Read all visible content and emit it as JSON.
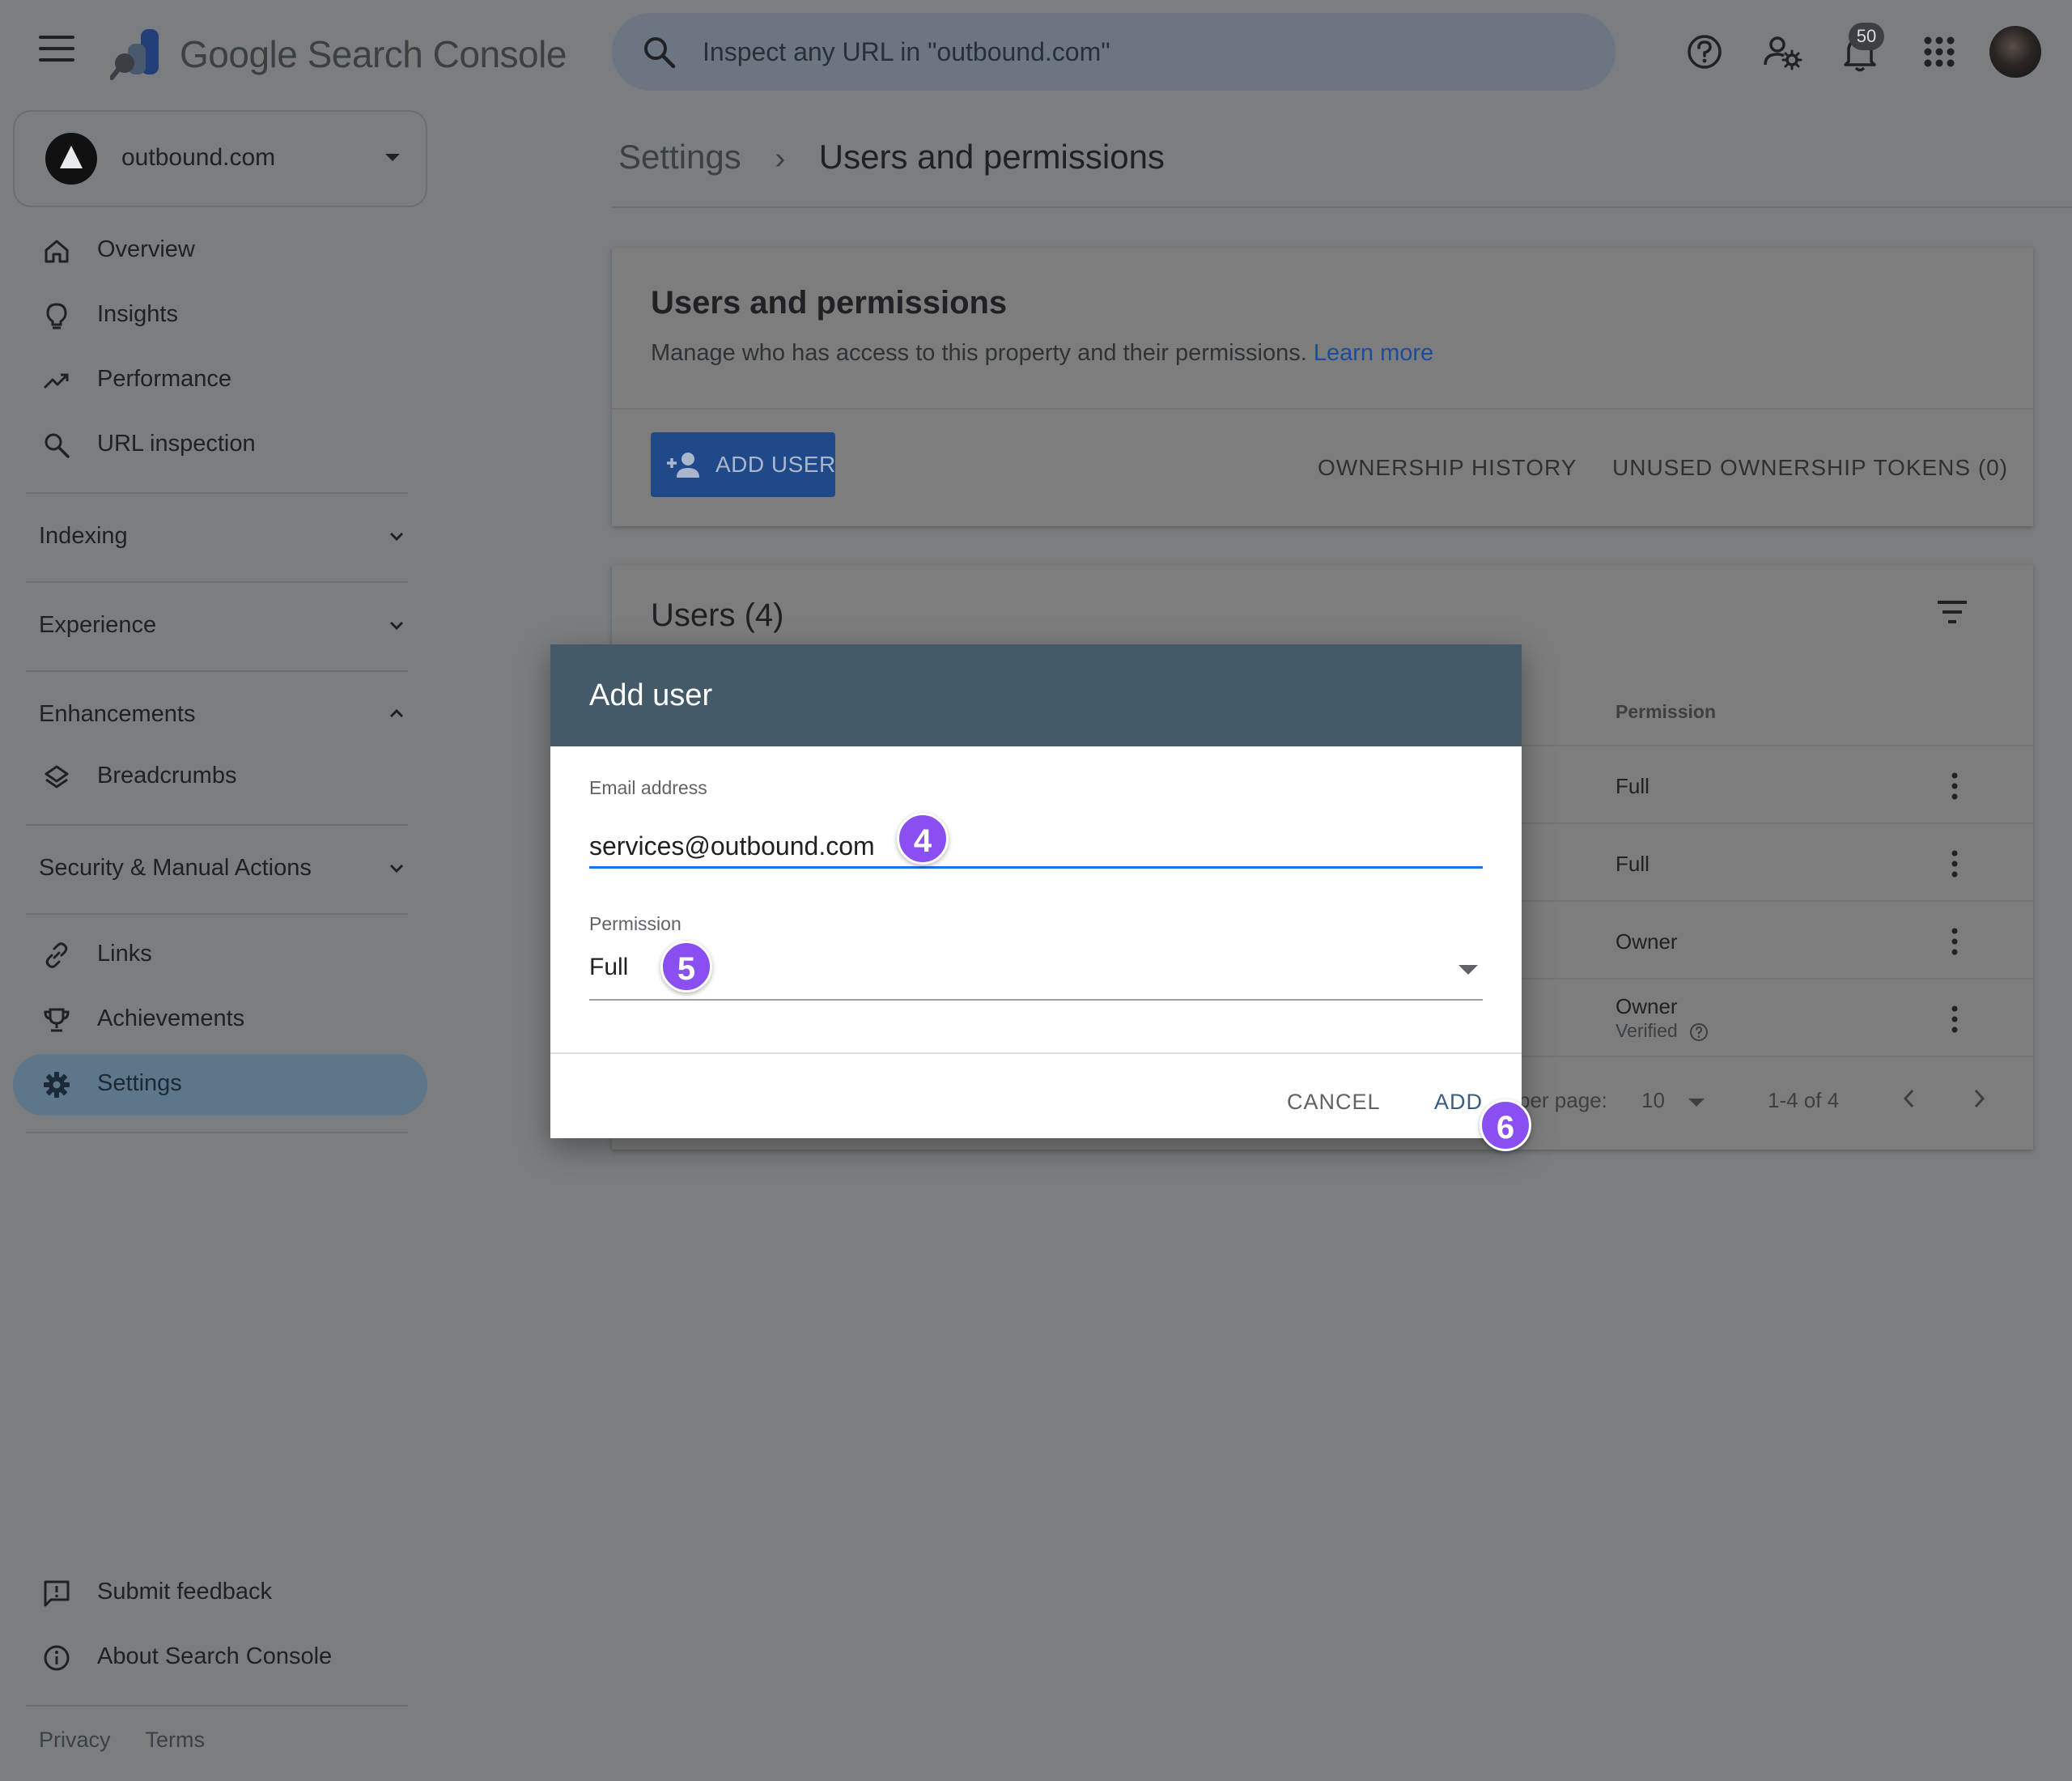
{
  "header": {
    "product_name": "Google Search Console",
    "search_placeholder": "Inspect any URL in \"outbound.com\"",
    "notification_count": "50",
    "icons": [
      "menu-icon",
      "help-icon",
      "search-settings-icon",
      "notifications-icon",
      "apps-icon",
      "avatar"
    ]
  },
  "sidebar": {
    "property": "outbound.com",
    "items": [
      {
        "label": "Overview",
        "icon": "home-icon"
      },
      {
        "label": "Insights",
        "icon": "lightbulb-icon"
      },
      {
        "label": "Performance",
        "icon": "trending-up-icon"
      },
      {
        "label": "URL inspection",
        "icon": "search-icon"
      }
    ],
    "sections": {
      "indexing": "Indexing",
      "experience": "Experience",
      "enhancements": "Enhancements",
      "breadcrumbs": "Breadcrumbs",
      "security": "Security & Manual Actions",
      "links": "Links",
      "achievements": "Achievements",
      "settings": "Settings"
    },
    "bottom": {
      "feedback": "Submit feedback",
      "about": "About Search Console",
      "privacy": "Privacy",
      "terms": "Terms"
    }
  },
  "breadcrumb": {
    "parent": "Settings",
    "current": "Users and permissions"
  },
  "permissions_card": {
    "title": "Users and permissions",
    "description": "Manage who has access to this property and their permissions.",
    "learn_more": "Learn more",
    "add_user": "ADD USER",
    "ownership_history": "OWNERSHIP HISTORY",
    "unused_tokens": "UNUSED OWNERSHIP TOKENS (0)"
  },
  "users_card": {
    "title": "Users (4)",
    "permission_header": "Permission",
    "rows": [
      {
        "permission": "Full",
        "sub": ""
      },
      {
        "permission": "Full",
        "sub": ""
      },
      {
        "permission": "Owner",
        "sub": ""
      },
      {
        "permission": "Owner",
        "sub": "Verified"
      }
    ],
    "rows_per_page_label": "per page:",
    "rows_per_page": "10",
    "range": "1-4 of 4"
  },
  "dialog": {
    "title": "Add user",
    "email_label": "Email address",
    "email_value": "services@outbound.com",
    "permission_label": "Permission",
    "permission_value": "Full",
    "cancel": "CANCEL",
    "add": "ADD"
  },
  "steps": [
    "4",
    "5",
    "6"
  ],
  "colors": {
    "overlay_bg": "#7a7e80",
    "dialog_header": "#455a69",
    "active_nav": "#5d7689",
    "focus_underline": "#1a73e8",
    "step_marker": "#8a4ff0"
  }
}
